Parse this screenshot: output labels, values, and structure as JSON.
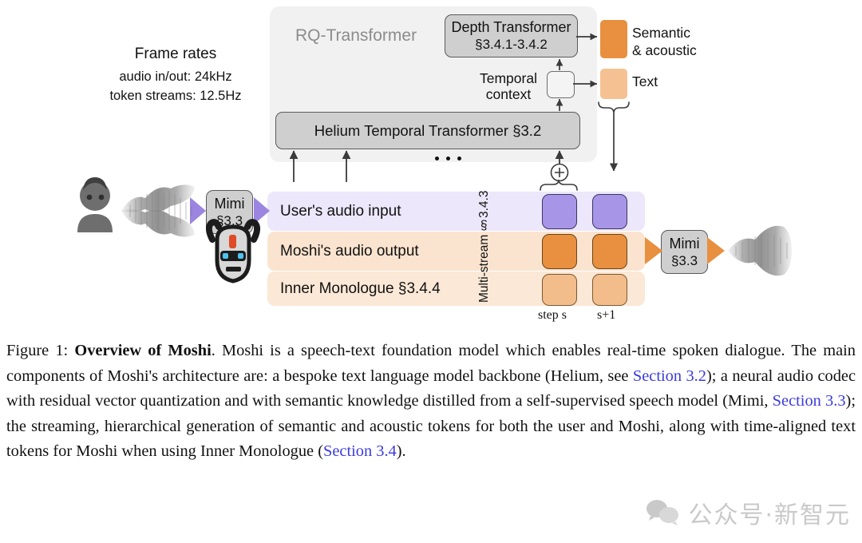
{
  "figure": {
    "rq_panel_label": "RQ-Transformer",
    "depth_transformer": {
      "line1": "Depth Transformer",
      "line2": "§3.4.1-3.4.2"
    },
    "temporal_context": {
      "line1": "Temporal",
      "line2": "context"
    },
    "helium": "Helium Temporal  Transformer §3.2",
    "frame_rates": {
      "title": "Frame rates",
      "line1": "audio in/out: 24kHz",
      "line2": "token streams: 12.5Hz"
    },
    "outputs": {
      "semantic_acoustic_line1": "Semantic",
      "semantic_acoustic_line2": "& acoustic",
      "text_label": "Text"
    },
    "mimi_in": {
      "line1": "Mimi",
      "line2": "§3.3"
    },
    "mimi_out": {
      "line1": "Mimi",
      "line2": "§3.3"
    },
    "streams": [
      {
        "label": "User's audio input",
        "bg": "#ece7fa",
        "token": "#a796e8"
      },
      {
        "label": "Moshi's audio output",
        "bg": "#fae4cf",
        "token": "#e8903f"
      },
      {
        "label": "Inner Monologue §3.4.4",
        "bg": "#fbe8d6",
        "token": "#f2bd8b"
      }
    ],
    "multistream_label": "Multi-stream",
    "multistream_section": "§3.4.3",
    "step_labels": {
      "current": "step s",
      "next": "s+1"
    },
    "plus_symbol": "+",
    "ellipsis": "• • •",
    "icons": {
      "user": "user-avatar-icon",
      "robot": "moshi-robot-icon",
      "waveform_in": "audio-waveform-icon",
      "waveform_out": "audio-waveform-icon"
    },
    "colors": {
      "purple_token": "#a796e8",
      "orange_token": "#e8903f",
      "peach_token": "#f2bd8b",
      "panel_grey": "#f1f1f1",
      "box_grey": "#cfcfcf",
      "link_blue": "#3b3bdd"
    }
  },
  "caption": {
    "figure_number": "Figure 1:",
    "bold_title": "Overview of Moshi",
    "body_1": ". Moshi is a speech-text foundation model which enables real-time spoken dialogue. The main components of Moshi's architecture are: a bespoke text language model backbone (Helium, see ",
    "link_1": "Section 3.2",
    "body_2": "); a neural audio codec with residual vector quantization and with semantic knowledge distilled from a self-supervised speech model (Mimi, ",
    "link_2": "Section 3.3",
    "body_3": "); the streaming, hierarchical generation of semantic and acoustic tokens for both the user and Moshi, along with time-aligned text tokens for Moshi when using Inner Monologue (",
    "link_3": "Section 3.4",
    "body_4": ")."
  },
  "watermark": {
    "text": "公众号·新智元",
    "icon": "wechat-icon"
  }
}
